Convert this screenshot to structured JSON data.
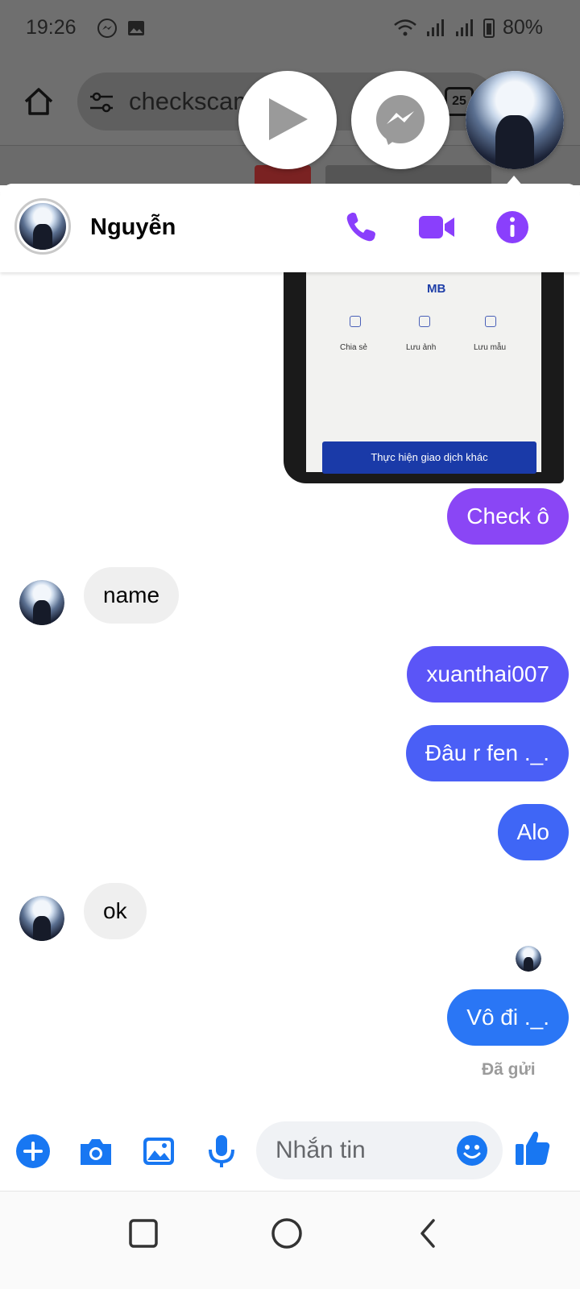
{
  "status_bar": {
    "time": "19:26",
    "battery": "80%"
  },
  "browser": {
    "url_text": "checkscam",
    "tab_count": "25"
  },
  "chat": {
    "contact_name": "Nguyễn",
    "shared_image": {
      "bank_label": "MB",
      "actions": [
        "Chia sẻ",
        "Lưu ảnh",
        "Lưu mẫu"
      ],
      "button_label": "Thực hiện giao dịch khác"
    },
    "messages": [
      {
        "dir": "out",
        "text": "Check ô"
      },
      {
        "dir": "in",
        "text": "name"
      },
      {
        "dir": "out",
        "text": "xuanthai007"
      },
      {
        "dir": "out",
        "text": "Đâu r fen ._."
      },
      {
        "dir": "out",
        "text": "Alo"
      },
      {
        "dir": "in",
        "text": "ok"
      },
      {
        "dir": "out",
        "text": "Vô đi ._."
      }
    ],
    "sent_status": "Đã gửi"
  },
  "composer": {
    "placeholder": "Nhắn tin"
  },
  "colors": {
    "messenger_purple": "#8a3ffc",
    "bubble_gradient": [
      "#8a46f5",
      "#4b5bf6",
      "#2f73f5",
      "#1a7cf5"
    ],
    "action_blue": "#1877f2"
  },
  "icons": [
    "home-icon",
    "tune-icon",
    "play-icon",
    "messenger-icon",
    "phone-icon",
    "video-icon",
    "info-icon",
    "plus-icon",
    "camera-icon",
    "gallery-icon",
    "mic-icon",
    "emoji-icon",
    "like-icon",
    "recent-apps-icon",
    "home-nav-icon",
    "back-icon"
  ]
}
